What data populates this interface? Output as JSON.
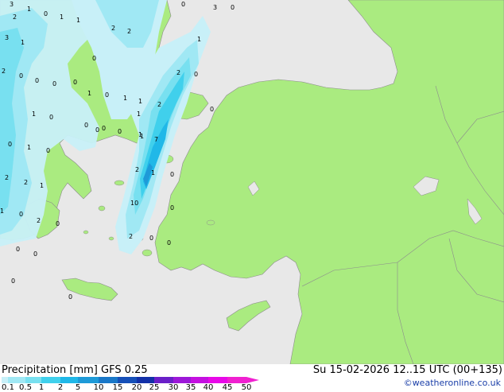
{
  "header": {
    "left_title": "Precipitation [mm] GFS 0.25",
    "right_title": "Su 15-02-2026 12..15 UTC (00+135)",
    "credit": "©weatheronline.co.uk"
  },
  "legend": {
    "ticks": [
      "0.1",
      "0.5",
      "1",
      "2",
      "5",
      "10",
      "15",
      "20",
      "25",
      "30",
      "35",
      "40",
      "45",
      "50"
    ],
    "colors": [
      "#c8f0f8",
      "#a0e8f4",
      "#78e0f0",
      "#40d0ec",
      "#20b8e8",
      "#1e9ad8",
      "#1a78c8",
      "#1650b8",
      "#1230a8",
      "#6a1fc8",
      "#9c18d8",
      "#c410e0",
      "#e808e8",
      "#f020d0"
    ]
  },
  "map": {
    "land_color": "#aaeb80",
    "sea_color": "#e8e8e8",
    "border_color": "#8c8c8c",
    "labels": [
      "3",
      "1",
      "0",
      "1",
      "1",
      "3",
      "0",
      "0",
      "2",
      "2",
      "3",
      "1",
      "1",
      "2",
      "0",
      "0",
      "0",
      "0",
      "0",
      "1",
      "2",
      "0",
      "1",
      "1",
      "0",
      "0",
      "0",
      "0",
      "1",
      "0",
      "1",
      "0",
      "0",
      "0",
      "1",
      "0",
      "2",
      "2",
      "0",
      "1",
      "7",
      "2",
      "1",
      "2",
      "1",
      "0",
      "2",
      "1",
      "2",
      "0",
      "0",
      "0",
      "10",
      "1",
      "2",
      "0",
      "0",
      "0",
      "0",
      "0"
    ]
  }
}
